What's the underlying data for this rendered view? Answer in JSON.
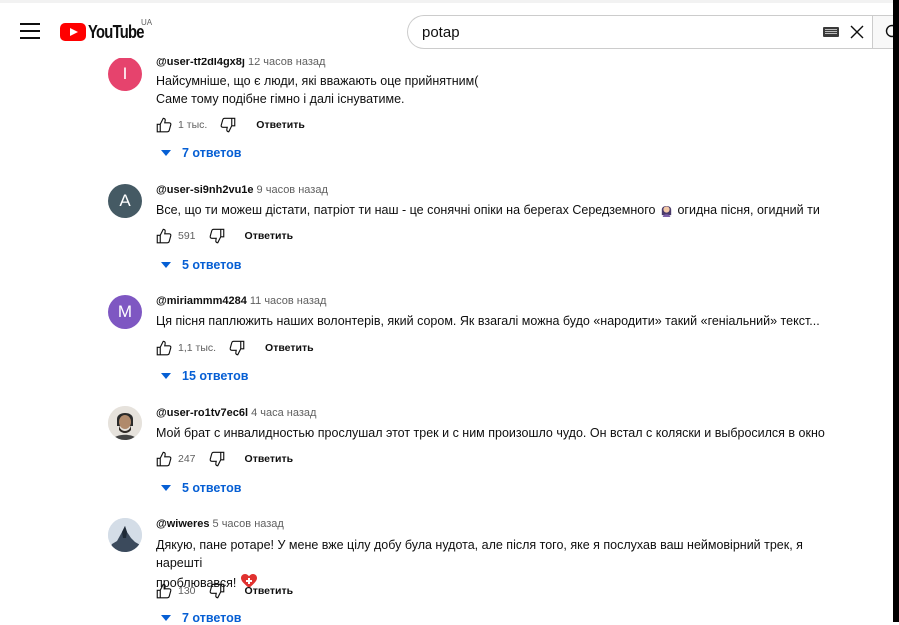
{
  "header": {
    "logo_text": "YouTube",
    "country": "UA",
    "search_value": "potap"
  },
  "comments": [
    {
      "author": "@user-tf2dl4gx8j",
      "time": "12 часов назад",
      "avatar_letter": "I",
      "avatar_color": "#e6436d",
      "text_lines": [
        "Найсумніше, що є люди, які вважають оце прийнятним(",
        "Саме тому подібне гімно і далі існуватиме."
      ],
      "likes": "1 тыс.",
      "reply_label": "Ответить",
      "replies_label": "7 ответов"
    },
    {
      "author": "@user-si9nh2vu1e",
      "time": "9 часов назад",
      "avatar_letter": "A",
      "avatar_color": "#455a64",
      "text_before": "Все, що ти можеш дістати, патріот ти наш - це сонячні опіки на берегах Середземного",
      "text_after": "огидна пісня, огидний ти",
      "likes": "591",
      "reply_label": "Ответить",
      "replies_label": "5 ответов"
    },
    {
      "author": "@miriammm4284",
      "time": "11 часов назад",
      "avatar_letter": "M",
      "avatar_color": "#7e57c2",
      "text": "Ця пісня паплюжить наших волонтерів, який сором. Як взагалі можна будо «народити» такий «геніальний» текст...",
      "likes": "1,1 тыс.",
      "reply_label": "Ответить",
      "replies_label": "15 ответов"
    },
    {
      "author": "@user-ro1tv7ec6l",
      "time": "4 часа назад",
      "text": "Мой брат с инвалидностью прослушал этот трек и с ним произошло чудо. Он встал с коляски и выбросился в окно",
      "likes": "247",
      "reply_label": "Ответить",
      "replies_label": "5 ответов"
    },
    {
      "author": "@wiweres",
      "time": "5 часов назад",
      "text_lines": [
        "Дякую, пане ротаре! У мене вже цілу добу була нудота, але після того, яке я послухав ваш неймовірний трек, я нарешті",
        "проблювався!"
      ],
      "likes": "130",
      "reply_label": "Ответить",
      "replies_label": "7 ответов"
    }
  ],
  "colors": {
    "accent_link": "#065fd4",
    "brand_red": "#ff0000"
  }
}
